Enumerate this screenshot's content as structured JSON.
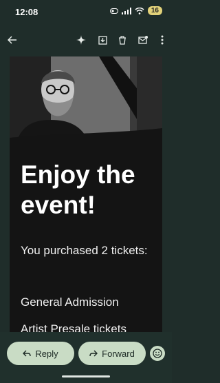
{
  "status_bar": {
    "time": "12:08",
    "battery": "16"
  },
  "toolbar": {
    "back_icon": "back-arrow-icon",
    "ai_icon": "sparkle-icon",
    "archive_icon": "archive-icon",
    "delete_icon": "trash-icon",
    "mark_unread_icon": "mail-unread-icon",
    "more_icon": "more-vertical-icon"
  },
  "email": {
    "headline": "Enjoy the event!",
    "purchase_text": "You purchased 2 tickets:",
    "ticket_line_1": "General Admission",
    "ticket_line_2": "Artist Presale tickets"
  },
  "actions": {
    "reply_label": "Reply",
    "forward_label": "Forward",
    "emoji_icon": "emoji-icon"
  },
  "colors": {
    "background": "#1f2d2a",
    "card": "#141414",
    "pill": "#c9dcc5"
  }
}
